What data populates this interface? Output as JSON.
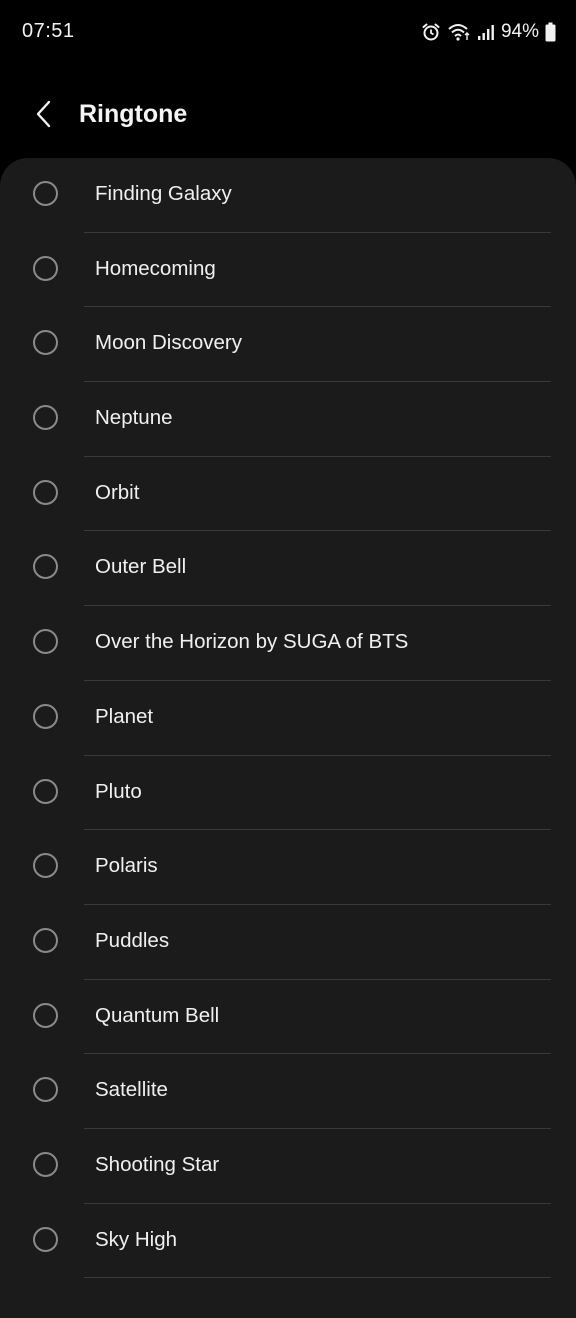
{
  "status_bar": {
    "time": "07:51",
    "battery_percent": "94%",
    "icons": [
      "alarm-icon",
      "wifi-icon",
      "signal-icon",
      "battery-icon"
    ]
  },
  "header": {
    "title": "Ringtone",
    "back_icon": "back-arrow-icon"
  },
  "ringtones": [
    {
      "label": "Finding Galaxy",
      "selected": false
    },
    {
      "label": "Homecoming",
      "selected": false
    },
    {
      "label": "Moon Discovery",
      "selected": false
    },
    {
      "label": "Neptune",
      "selected": false
    },
    {
      "label": "Orbit",
      "selected": false
    },
    {
      "label": "Outer Bell",
      "selected": false
    },
    {
      "label": "Over the Horizon by SUGA of BTS",
      "selected": false
    },
    {
      "label": "Planet",
      "selected": false
    },
    {
      "label": "Pluto",
      "selected": false
    },
    {
      "label": "Polaris",
      "selected": false
    },
    {
      "label": "Puddles",
      "selected": false
    },
    {
      "label": "Quantum Bell",
      "selected": false
    },
    {
      "label": "Satellite",
      "selected": false
    },
    {
      "label": "Shooting Star",
      "selected": false
    },
    {
      "label": "Sky High",
      "selected": false
    }
  ],
  "colors": {
    "background": "#000000",
    "card": "#1b1b1b",
    "text": "#f0f0f0",
    "radio_border": "#8a8a8a",
    "divider": "#3a3a3a"
  }
}
